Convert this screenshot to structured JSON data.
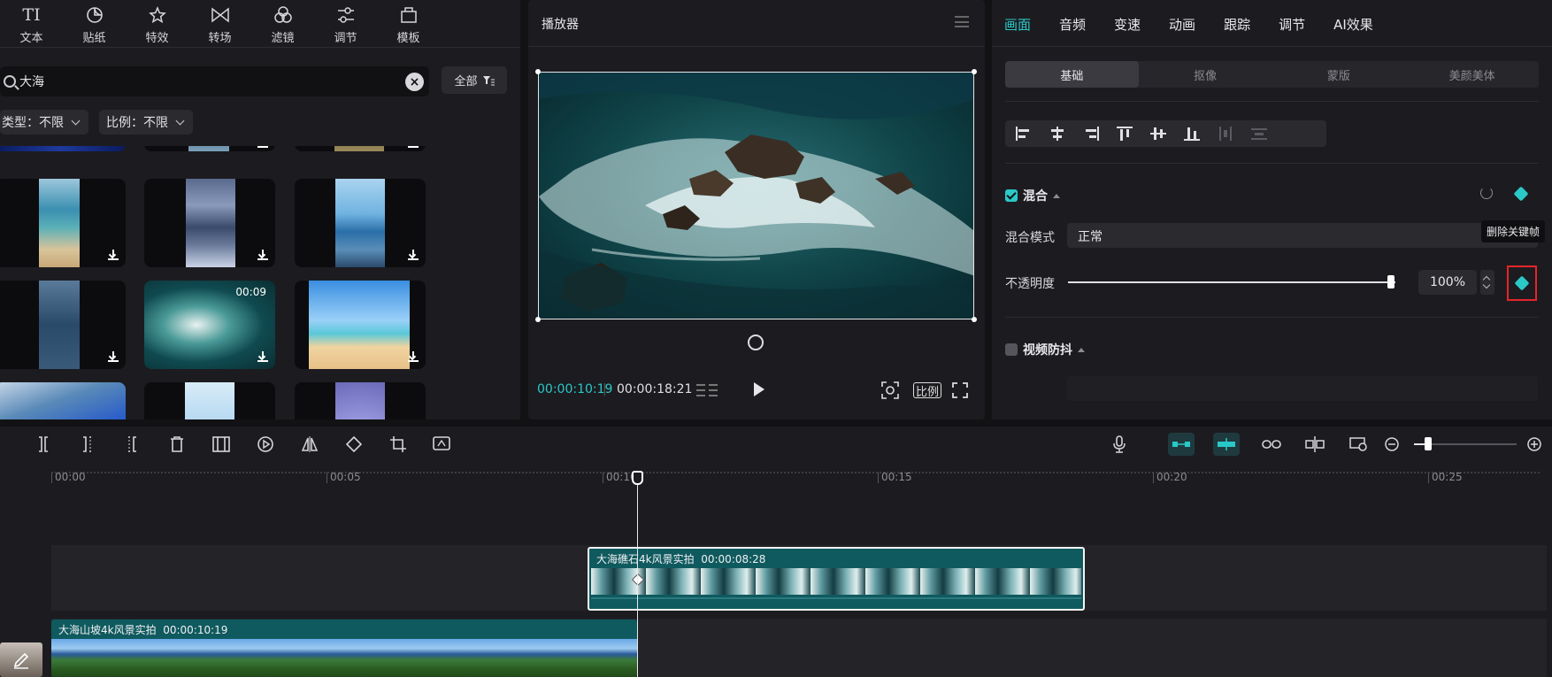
{
  "left": {
    "tools": [
      {
        "label": "文本",
        "icon": "text-icon"
      },
      {
        "label": "贴纸",
        "icon": "sticker-icon"
      },
      {
        "label": "特效",
        "icon": "effects-star-icon"
      },
      {
        "label": "转场",
        "icon": "transition-icon"
      },
      {
        "label": "滤镜",
        "icon": "filter-icon"
      },
      {
        "label": "调节",
        "icon": "adjust-icon"
      },
      {
        "label": "模板",
        "icon": "template-icon"
      }
    ],
    "search": {
      "value": "大海"
    },
    "all_button": "全部",
    "filters": {
      "type_label": "类型：不限",
      "ratio_label": "比例：不限"
    },
    "media": [
      {
        "duration": "00:09"
      }
    ]
  },
  "player": {
    "title": "播放器",
    "current_time": "00:00:10:19",
    "total_time": "00:00:18:21",
    "ratio_button": "比例"
  },
  "props": {
    "tabs": [
      {
        "label": "画面",
        "active": true
      },
      {
        "label": "音频"
      },
      {
        "label": "变速"
      },
      {
        "label": "动画"
      },
      {
        "label": "跟踪"
      },
      {
        "label": "调节"
      },
      {
        "label": "AI效果"
      }
    ],
    "subtabs": [
      {
        "label": "基础",
        "active": true
      },
      {
        "label": "抠像"
      },
      {
        "label": "蒙版"
      },
      {
        "label": "美颜美体"
      }
    ],
    "blend_section": {
      "title": "混合",
      "checked": true,
      "mode_label": "混合模式",
      "mode_value": "正常",
      "opacity_label": "不透明度",
      "opacity_value": "100%",
      "opacity_fraction": 1.0
    },
    "tooltip": "删除关键帧",
    "stabilize_section": {
      "title": "视频防抖",
      "checked": false
    }
  },
  "timeline": {
    "ruler": [
      "00:00",
      "00:05",
      "00:10",
      "00:15",
      "00:20",
      "00:25"
    ],
    "clips": [
      {
        "title": "大海礁石4k风景实拍",
        "duration": "00:00:08:28"
      },
      {
        "title": "大海山坡4k风景实拍",
        "duration": "00:00:10:19"
      }
    ]
  },
  "colors": {
    "accent": "#2bc8c8",
    "highlight_box": "#e6242a",
    "clip_teal": "#0f5a5e"
  }
}
